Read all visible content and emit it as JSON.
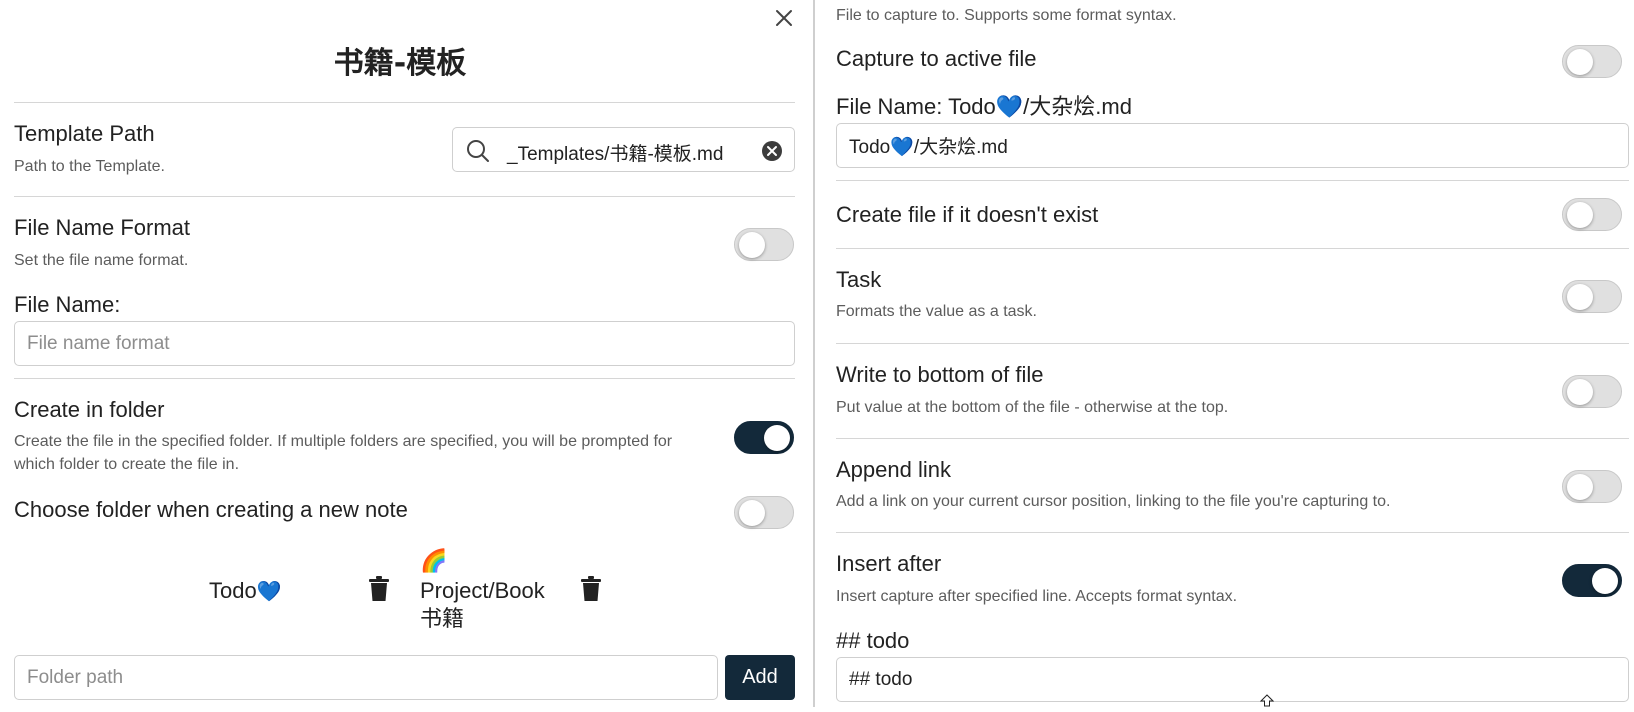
{
  "left": {
    "title": "书籍-模板",
    "template_path": {
      "name": "Template Path",
      "desc": "Path to the Template.",
      "value": "_Templates/书籍-模板.md"
    },
    "file_name_format": {
      "name": "File Name Format",
      "desc": "Set the file name format.",
      "enabled": false
    },
    "file_name": {
      "label": "File Name:",
      "placeholder": "File name format"
    },
    "create_in_folder": {
      "name": "Create in folder",
      "desc": "Create the file in the specified folder. If multiple folders are specified, you will be prompted for which folder to create the file in.",
      "enabled": true
    },
    "choose_folder": {
      "name": "Choose folder when creating a new note",
      "enabled": false
    },
    "folders": [
      {
        "label": "Todo",
        "emoji": "💙"
      },
      {
        "emoji": "🌈",
        "label": "Project/Book 书籍"
      }
    ],
    "folder_input": {
      "placeholder": "Folder path"
    },
    "add_label": "Add"
  },
  "right": {
    "top_desc": "File to capture to. Supports some format syntax.",
    "capture_active": {
      "name": "Capture to active file",
      "enabled": false
    },
    "file_name": {
      "label": "File Name: Todo💙/大杂烩.md",
      "value": "Todo💙/大杂烩.md"
    },
    "create_file": {
      "name": "Create file if it doesn't exist",
      "enabled": false
    },
    "task": {
      "name": "Task",
      "desc": "Formats the value as a task.",
      "enabled": false
    },
    "write_bottom": {
      "name": "Write to bottom of file",
      "desc": "Put value at the bottom of the file - otherwise at the top.",
      "enabled": false
    },
    "append_link": {
      "name": "Append link",
      "desc": "Add a link on your current cursor position, linking to the file you're capturing to.",
      "enabled": false
    },
    "insert_after": {
      "name": "Insert after",
      "desc": "Insert capture after specified line. Accepts format syntax.",
      "enabled": true
    },
    "insert_after_line": {
      "label": "## todo",
      "value": "## todo"
    }
  },
  "colors": {
    "toggle_on": "#13293a",
    "accent_heart": "#1e6fd9"
  },
  "icons": [
    "close-icon",
    "search-icon",
    "clear-icon",
    "trash-icon",
    "rainbow-icon",
    "heart-icon",
    "cursor-icon"
  ]
}
